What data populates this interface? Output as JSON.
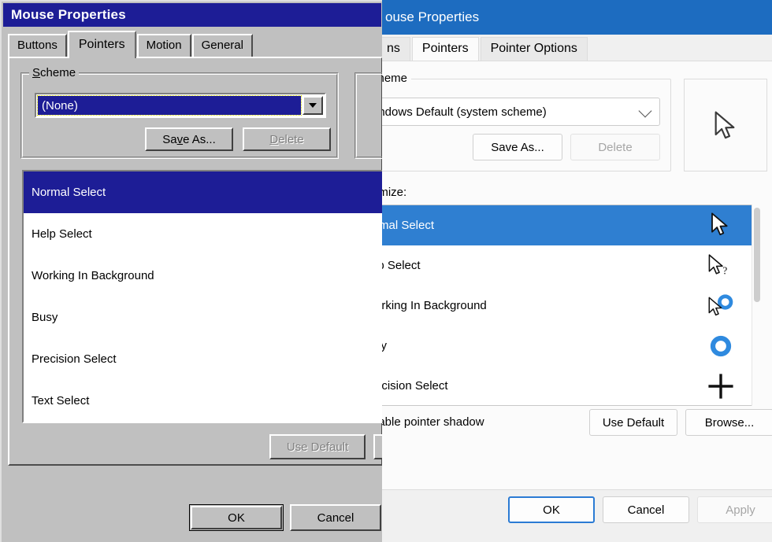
{
  "classic_dialog": {
    "title": "Mouse Properties",
    "tabs": [
      {
        "label": "Buttons",
        "active": false
      },
      {
        "label": "Pointers",
        "active": true
      },
      {
        "label": "Motion",
        "active": false
      },
      {
        "label": "General",
        "active": false
      }
    ],
    "scheme_group_label": "Scheme",
    "scheme_value": "(None)",
    "save_as_label": "Save As...",
    "delete_label": "Delete",
    "delete_disabled": true,
    "pointer_items": [
      "Normal Select",
      "Help Select",
      "Working In Background",
      "Busy",
      "Precision Select",
      "Text Select"
    ],
    "selected_pointer": "Normal Select",
    "use_default_label": "Use Default",
    "use_default_disabled": true,
    "ok_label": "OK",
    "cancel_label": "Cancel",
    "titlebar_color": "#1d1d96",
    "face_color": "#c0c0c0"
  },
  "modern_dialog": {
    "title": "ouse Properties",
    "tabs": [
      {
        "label": "ns",
        "active": false
      },
      {
        "label": "Pointers",
        "active": true
      },
      {
        "label": "Pointer Options",
        "active": false
      }
    ],
    "scheme_group_label": "cheme",
    "scheme_value": "indows Default (system scheme)",
    "save_as_label": "Save As...",
    "delete_label": "Delete",
    "delete_disabled": true,
    "customize_label": "omize:",
    "pointer_items": [
      {
        "label": "rmal Select",
        "icon": "arrow-cursor-icon"
      },
      {
        "label": "lp Select",
        "icon": "arrow-help-cursor-icon"
      },
      {
        "label": "orking In Background",
        "icon": "arrow-busy-cursor-icon"
      },
      {
        "label": "sy",
        "icon": "busy-ring-cursor-icon"
      },
      {
        "label": "ecision Select",
        "icon": "crosshair-cursor-icon"
      }
    ],
    "selected_pointer": "rmal Select",
    "shadow_checkbox_label": "nable pointer shadow",
    "use_default_label": "Use Default",
    "browse_label": "Browse...",
    "ok_label": "OK",
    "cancel_label": "Cancel",
    "apply_label": "Apply",
    "apply_disabled": true,
    "titlebar_color": "#1d6cc0",
    "accent_color": "#2f7fd1"
  }
}
